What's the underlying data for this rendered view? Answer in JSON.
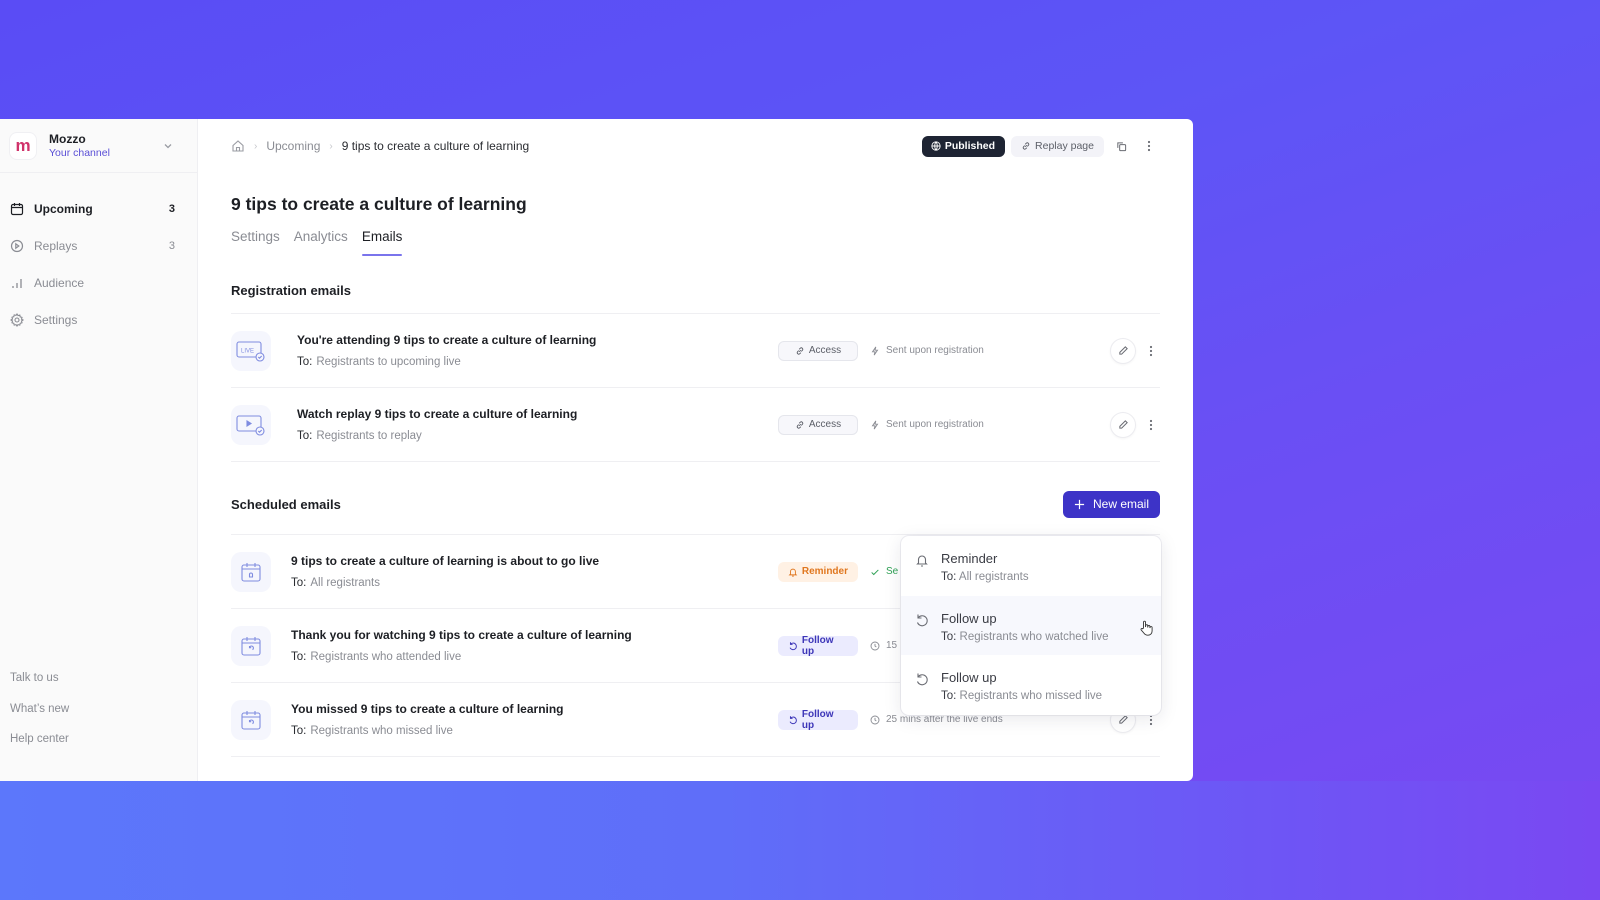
{
  "channel": {
    "name": "Mozzo",
    "subtitle": "Your channel",
    "logo_letter": "m",
    "brand_color": "#d0326a"
  },
  "sidebar": {
    "items": [
      {
        "label": "Upcoming",
        "count": "3",
        "icon": "calendar-icon",
        "active": true
      },
      {
        "label": "Replays",
        "count": "3",
        "icon": "play-circle-icon",
        "active": false
      },
      {
        "label": "Audience",
        "count": "",
        "icon": "bar-chart-icon",
        "active": false
      },
      {
        "label": "Settings",
        "count": "",
        "icon": "gear-icon",
        "active": false
      }
    ],
    "footer": [
      "Talk to us",
      "What’s new",
      "Help center"
    ]
  },
  "breadcrumb": {
    "home_icon": "home-icon",
    "items": [
      "Upcoming",
      "9 tips to create a culture of learning"
    ]
  },
  "toolbar": {
    "published_label": "Published",
    "replay_label": "Replay page",
    "copy_icon": "copy-icon",
    "more_icon": "more-vertical-icon"
  },
  "page": {
    "title": "9 tips to create a culture of learning",
    "tabs": [
      {
        "label": "Settings",
        "active": false
      },
      {
        "label": "Analytics",
        "active": false
      },
      {
        "label": "Emails",
        "active": true
      }
    ]
  },
  "registration": {
    "title": "Registration emails",
    "rows": [
      {
        "title": "You're attending 9 tips to create a culture of learning",
        "to_label": "To:",
        "to": "Registrants to upcoming live",
        "badge": "Access",
        "meta": "Sent upon registration",
        "thumb": "live-icon"
      },
      {
        "title": "Watch replay 9 tips to create a culture of learning",
        "to_label": "To:",
        "to": "Registrants to replay",
        "badge": "Access",
        "meta": "Sent upon registration",
        "thumb": "replay-video-icon"
      }
    ]
  },
  "scheduled": {
    "title": "Scheduled emails",
    "new_label": "New email",
    "rows": [
      {
        "title": "9 tips to create a culture of learning is about to go live",
        "to_label": "To:",
        "to": "All registrants",
        "badge": "Reminder",
        "meta": "Se",
        "thumb": "calendar-bell-icon"
      },
      {
        "title": "Thank you for watching 9 tips to create a culture of learning",
        "to_label": "To:",
        "to": "Registrants who attended live",
        "badge": "Follow up",
        "meta": "15",
        "thumb": "calendar-refresh-icon"
      },
      {
        "title": "You missed 9 tips to create a culture of learning",
        "to_label": "To:",
        "to": "Registrants who missed live",
        "badge": "Follow up",
        "meta": "25 mins after the live ends",
        "thumb": "calendar-refresh-icon"
      }
    ]
  },
  "dropdown": {
    "items": [
      {
        "title": "Reminder",
        "to_label": "To:",
        "to": "All registrants",
        "icon": "bell-icon"
      },
      {
        "title": "Follow up",
        "to_label": "To:",
        "to": "Registrants who watched live",
        "icon": "refresh-icon",
        "hovered": true
      },
      {
        "title": "Follow up",
        "to_label": "To:",
        "to": "Registrants who missed live",
        "icon": "refresh-icon"
      }
    ]
  },
  "colors": {
    "accent": "#3d33c7",
    "tab_underline": "#7a74ec",
    "published_bg": "#1e2433",
    "reminder": "#e0771f",
    "follow_up": "#3d36b8",
    "success": "#2fa155"
  }
}
